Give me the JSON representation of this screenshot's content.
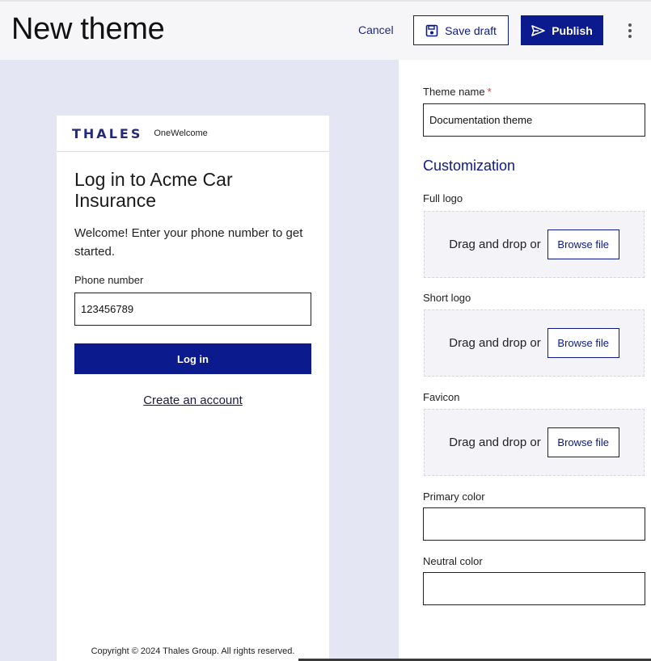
{
  "header": {
    "title": "New theme",
    "cancel_label": "Cancel",
    "save_draft_label": "Save draft",
    "publish_label": "Publish"
  },
  "preview": {
    "brand_name": "THALES",
    "product_name": "OneWelcome",
    "login_title": "Log in to Acme Car Insurance",
    "welcome_text": "Welcome! Enter your phone number to get started.",
    "phone_label": "Phone number",
    "phone_value": "123456789",
    "login_button": "Log in",
    "create_account_link": "Create an account",
    "copyright": "Copyright © 2024 Thales Group. All rights reserved."
  },
  "form": {
    "theme_name_label": "Theme name",
    "required_marker": "*",
    "theme_name_value": "Documentation theme",
    "section_title": "Customization",
    "full_logo_label": "Full logo",
    "short_logo_label": "Short logo",
    "favicon_label": "Favicon",
    "dropzone_text": "Drag and drop or",
    "browse_label": "Browse file",
    "primary_color_label": "Primary color",
    "primary_color_value": "",
    "neutral_color_label": "Neutral color",
    "neutral_color_value": ""
  },
  "colors": {
    "accent": "#0b1a8c",
    "preview_background": "#e4e6f4",
    "header_background": "#f6f6f9",
    "required": "#d23c3c"
  },
  "icons": {
    "save": "floppy-disk-icon",
    "publish": "paper-plane-icon",
    "more": "kebab-menu-icon"
  }
}
